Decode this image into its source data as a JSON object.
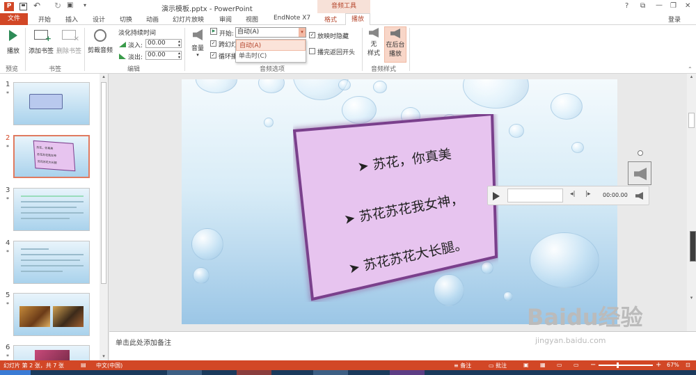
{
  "app": {
    "title": "演示模板.pptx - PowerPoint",
    "context_tab_group": "音频工具",
    "login": "登录",
    "window_controls": [
      "?",
      "⧉",
      "—",
      "❐",
      "✕"
    ]
  },
  "tabs": [
    "文件",
    "开始",
    "插入",
    "设计",
    "切换",
    "动画",
    "幻灯片放映",
    "审阅",
    "视图",
    "EndNote X7",
    "格式",
    "播放"
  ],
  "ribbon": {
    "preview": {
      "play": "播放",
      "group": "预览"
    },
    "bookmarks": {
      "add": "添加书签",
      "remove": "删除书签",
      "group": "书签"
    },
    "editing": {
      "trim": "剪裁音频",
      "fade_title": "淡化持续时间",
      "fade_in_label": "淡入:",
      "fade_in_value": "00.00",
      "fade_out_label": "淡出:",
      "fade_out_value": "00.00",
      "group": "编辑"
    },
    "audio_options": {
      "volume": "音量",
      "start_label": "开始:",
      "start_value": "自动(A)",
      "across_slides": "跨幻灯",
      "loop": "循环播",
      "hide_during_show": "放映时隐藏",
      "rewind": "播完返回开头",
      "group": "音频选项"
    },
    "audio_styles": {
      "none_line1": "无",
      "none_line2": "样式",
      "bg_line1": "在后台",
      "bg_line2": "播放",
      "group": "音频样式"
    }
  },
  "dropdown": {
    "options": [
      "自动(A)",
      "单击时(C)"
    ]
  },
  "thumbnails": [
    {
      "num": "1",
      "star": "*"
    },
    {
      "num": "2",
      "star": "*"
    },
    {
      "num": "3",
      "star": "*"
    },
    {
      "num": "4",
      "star": "*"
    },
    {
      "num": "5",
      "star": "*"
    },
    {
      "num": "6",
      "star": "*"
    }
  ],
  "thumb2_lines": [
    "苏花，你真美",
    "苏花苏花我女神",
    "苏花苏花大长腿"
  ],
  "slide": {
    "lines": [
      "苏花，你真美",
      "苏花苏花我女神，",
      "苏花苏花大长腿。"
    ],
    "bullet": "➤"
  },
  "player": {
    "time": "00:00.00"
  },
  "notes": {
    "placeholder": "单击此处添加备注"
  },
  "status": {
    "slide_info": "幻灯片 第 2 张，共 7 张",
    "language": "中文(中国)",
    "notes": "备注",
    "comments": "批注",
    "zoom": "67%"
  },
  "watermark": {
    "brand": "Baidu经验",
    "url": "jingyan.baidu.com"
  },
  "colors": {
    "accent": "#d24726",
    "slide_box": "#e7c4ef",
    "slide_box_border": "#7a3f8c"
  }
}
